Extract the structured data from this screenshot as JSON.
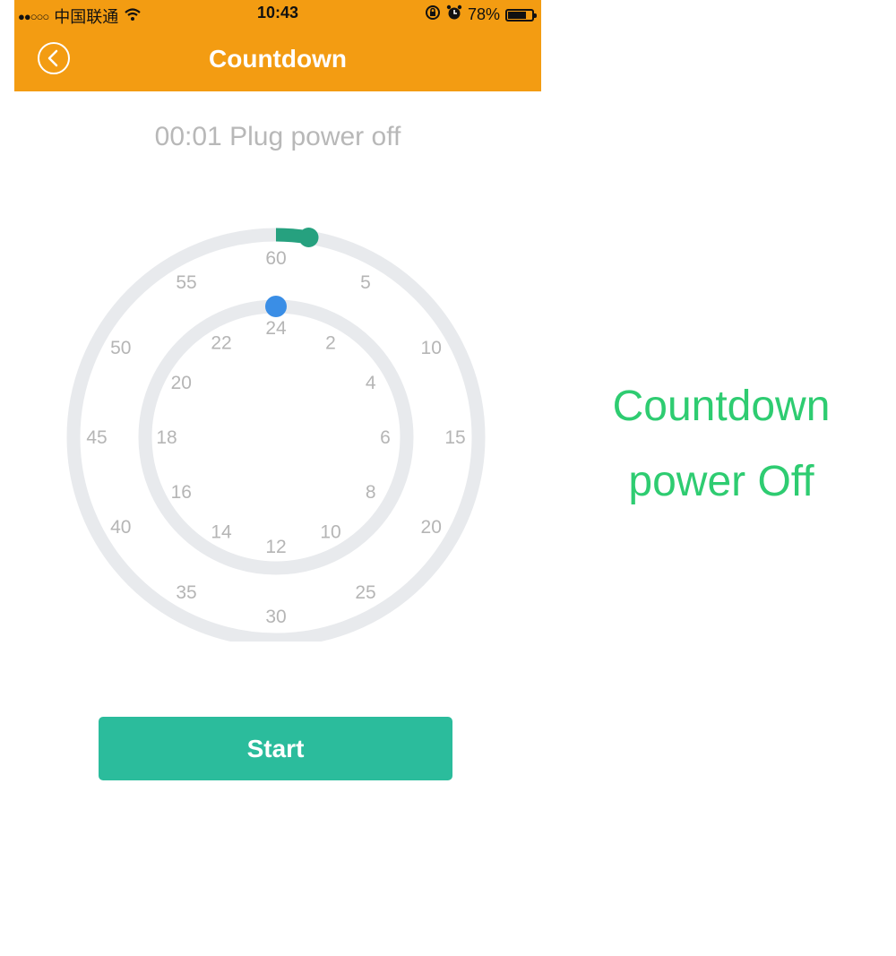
{
  "status_bar": {
    "signal_dots": "●●○○○",
    "carrier": "中国联通",
    "time": "10:43",
    "battery_percent": "78%",
    "battery_level": 0.78,
    "icons": [
      "wifi-icon",
      "rotation-lock-icon",
      "alarm-icon",
      "battery-icon"
    ]
  },
  "nav": {
    "title": "Countdown",
    "back_icon": "chevron-left-icon"
  },
  "status_text": "00:01 Plug power off",
  "dial": {
    "outer_ticks": [
      "60",
      "5",
      "10",
      "15",
      "20",
      "25",
      "30",
      "35",
      "40",
      "45",
      "50",
      "55"
    ],
    "inner_ticks": [
      "24",
      "2",
      "4",
      "6",
      "8",
      "10",
      "12",
      "14",
      "16",
      "18",
      "20",
      "22"
    ],
    "minutes_selected": 1,
    "hours_selected": 0,
    "colors": {
      "track": "#e8eaed",
      "minute_handle": "#26a17f",
      "hour_handle": "#3a8ee6"
    }
  },
  "start_button": {
    "label": "Start"
  },
  "caption": {
    "line1": "Countdown",
    "line2": "power Off"
  },
  "colors": {
    "header": "#f39c12",
    "button": "#2bbc9c",
    "caption": "#2ecc71"
  }
}
